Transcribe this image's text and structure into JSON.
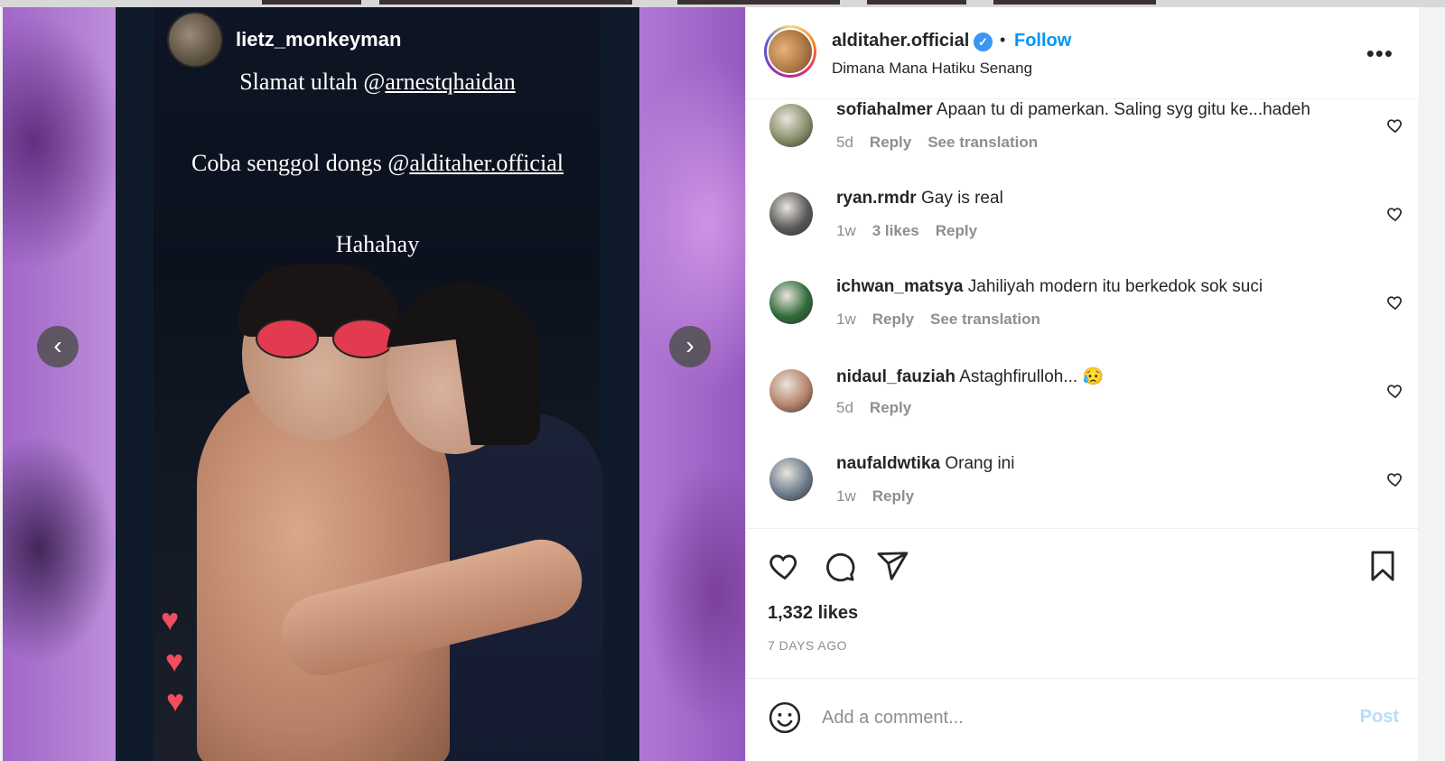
{
  "story": {
    "username": "lietz_monkeyman",
    "line1_prefix": "Slamat ultah @",
    "line1_mention": "arnestqhaidan",
    "line2_prefix": "Coba senggol dongs @",
    "line2_mention": "alditaher.official",
    "line3": "Hahahay"
  },
  "media_nav": {
    "prev_icon": "‹",
    "next_icon": "›"
  },
  "post": {
    "username": "alditaher.official",
    "verified_icon": "✓",
    "separator": "•",
    "follow_label": "Follow",
    "subtitle": "Dimana Mana Hatiku Senang",
    "more_icon": "•••"
  },
  "comments": [
    {
      "user": "sofiahalmer",
      "text": "Apaan tu di pamerkan. Saling syg gitu ke...hadeh",
      "time": "5d",
      "likes": "",
      "reply": "Reply",
      "translate": "See translation",
      "avatar_color": "#8a8f6a"
    },
    {
      "user": "ryan.rmdr",
      "text": "Gay is real",
      "time": "1w",
      "likes": "3 likes",
      "reply": "Reply",
      "translate": "",
      "avatar_color": "#5a5a5a"
    },
    {
      "user": "ichwan_matsya",
      "text": "Jahiliyah modern itu berkedok sok suci",
      "time": "1w",
      "likes": "",
      "reply": "Reply",
      "translate": "See translation",
      "avatar_color": "#2f6b3a"
    },
    {
      "user": "nidaul_fauziah",
      "text": "Astaghfirulloh... 😥",
      "time": "5d",
      "likes": "",
      "reply": "Reply",
      "translate": "",
      "avatar_color": "#b7846c"
    },
    {
      "user": "naufaldwtika",
      "text": "Orang ini",
      "time": "1w",
      "likes": "",
      "reply": "Reply",
      "translate": "",
      "avatar_color": "#6d7d8e"
    }
  ],
  "stats": {
    "likes": "1,332 likes",
    "ago": "7 DAYS AGO"
  },
  "composer": {
    "placeholder": "Add a comment...",
    "post_label": "Post"
  },
  "colors": {
    "accent": "#0095f6",
    "post_disabled": "#b2dffc",
    "like_red": "#f24d5e"
  }
}
